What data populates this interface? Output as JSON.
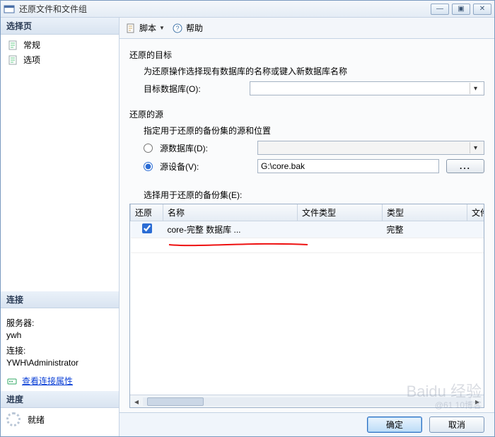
{
  "title": "还原文件和文件组",
  "winbtns": {
    "min": "—",
    "max": "▣",
    "close": "✕"
  },
  "sidebar": {
    "select_pages": "选择页",
    "items": [
      {
        "label": "常规"
      },
      {
        "label": "选项"
      }
    ],
    "connection": {
      "title": "连接",
      "server_label": "服务器:",
      "server_value": "ywh",
      "conn_label": "连接:",
      "conn_value": "YWH\\Administrator",
      "view_props": "查看连接属性"
    },
    "progress": {
      "title": "进度",
      "status": "就绪"
    }
  },
  "toolbar": {
    "script": "脚本",
    "help": "帮助"
  },
  "sections": {
    "target": {
      "title": "还原的目标",
      "desc": "为还原操作选择现有数据库的名称或键入新数据库名称",
      "target_db_label": "目标数据库(O):",
      "target_db_value": ""
    },
    "source": {
      "title": "还原的源",
      "desc": "指定用于还原的备份集的源和位置",
      "radio_db_label": "源数据库(D):",
      "radio_db_value": "",
      "radio_device_label": "源设备(V):",
      "device_value": "G:\\core.bak",
      "browse": "..."
    },
    "sets": {
      "title": "选择用于还原的备份集(E):",
      "columns": [
        "还原",
        "名称",
        "文件类型",
        "类型",
        "文件"
      ],
      "rows": [
        {
          "checked": true,
          "name": "core-完整 数据库 ...",
          "filetype": "",
          "type": "完整",
          "file": ""
        }
      ]
    }
  },
  "footer": {
    "ok": "确定",
    "cancel": "取消"
  },
  "watermark": {
    "brand": "Baidu 经验",
    "sub": "@61 10博客"
  }
}
